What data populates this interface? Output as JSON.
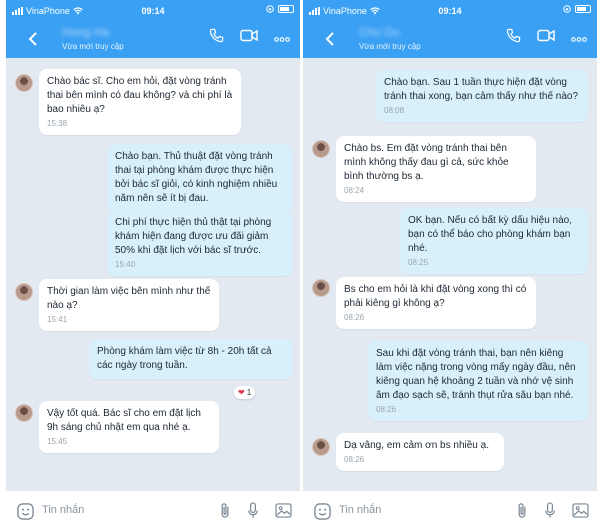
{
  "colors": {
    "header": "#3aa0f3",
    "chat_bg": "#e2e9f1",
    "incoming": "#ffffff",
    "outgoing": "#d8f0fc",
    "heart": "#e23a4e"
  },
  "left": {
    "status": {
      "carrier": "VinaPhone",
      "time": "09:14"
    },
    "header": {
      "name": "Hong Ha",
      "subtitle": "Vừa mới truy cập"
    },
    "messages": [
      {
        "text": "Chào bác sĩ. Cho em hỏi, đặt vòng tránh thai bên mình có đau không? và chi phí là bao nhiêu ạ?",
        "time": "15:38"
      },
      {
        "text": "Chào bạn. Thủ thuật đặt vòng tránh thai tại phòng khám được thực hiện bởi bác sĩ giỏi, có kinh nghiệm nhiều năm nên sẽ ít bị đau."
      },
      {
        "text": "Chi phí thực hiện thủ thật tại phòng khám hiện đang được ưu đãi giảm 50% khi đặt lịch với bác sĩ trước.",
        "time": "15:40"
      },
      {
        "text": "Thời gian làm việc bên mình như thế nào ạ?",
        "time": "15:41"
      },
      {
        "text": "Phòng khám làm việc từ 8h - 20h tất cả các ngày trong tuần.",
        "reaction": "1"
      },
      {
        "text": "Vậy tốt quá. Bác sĩ cho em đặt lịch 9h sáng chủ nhật em qua nhé ạ.",
        "time": "15:45"
      }
    ],
    "input_placeholder": "Tin nhắn"
  },
  "right": {
    "status": {
      "carrier": "VinaPhone",
      "time": "09:14"
    },
    "header": {
      "name": "Chu Du",
      "subtitle": "Vừa mới truy cập"
    },
    "messages": [
      {
        "text": "Chào bạn. Sau 1 tuần thực hiện đặt vòng tránh thai xong, bạn cảm thấy như thế nào?",
        "time": "08:08"
      },
      {
        "text": "Chào bs. Em đặt vòng tránh thai bên mình không thấy đau gì cả, sức khỏe bình thường bs ạ.",
        "time": "08:24"
      },
      {
        "text": "OK bạn. Nếu có bất kỳ dấu hiệu nào, bạn có thể báo cho phòng khám bạn nhé.",
        "time": "08:25"
      },
      {
        "text": "Bs cho em hỏi là khi đặt vòng xong thì có phải kiêng gì không ạ?",
        "time": "08:26"
      },
      {
        "text": "Sau khi đặt vòng tránh thai, bạn nên kiêng làm việc nặng trong vòng mấy ngày đầu, nên kiêng quan hệ khoảng 2 tuần và nhớ vệ sinh âm đạo sạch sẽ, tránh thụt rửa sâu bạn nhé.",
        "time": "08:26"
      },
      {
        "text": "Dạ vâng, em cảm ơn bs nhiều ạ.",
        "time": "08:26"
      }
    ],
    "input_placeholder": "Tin nhắn"
  }
}
